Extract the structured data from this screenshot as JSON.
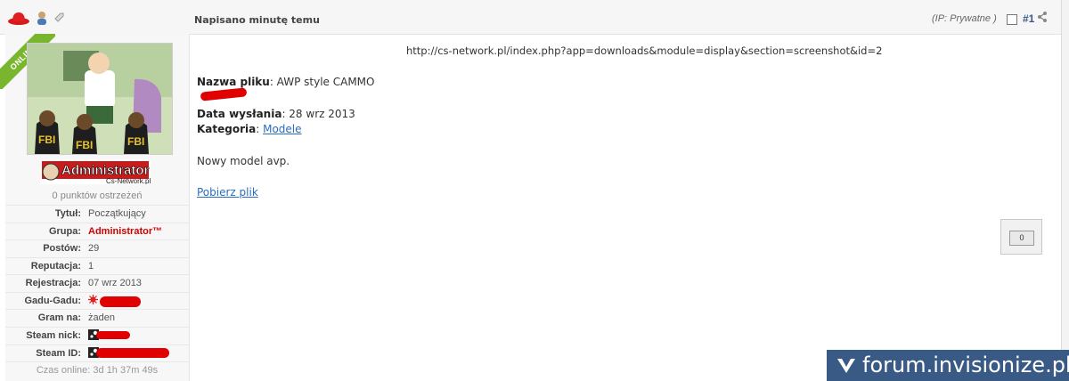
{
  "header": {
    "posted_time": "Napisano minutę temu",
    "ip_label": "(IP: Prywatne )",
    "post_number": "#1"
  },
  "author": {
    "online_label": "ONLINE",
    "rank_image_text": "Administrator",
    "rank_image_subtext": "Cs-Network.pl",
    "warnings": "0 punktów ostrzeżeń",
    "fields": {
      "title_label": "Tytuł:",
      "title_value": "Początkujący",
      "group_label": "Grupa:",
      "group_value": "Administrator™",
      "posts_label": "Postów:",
      "posts_value": "29",
      "rep_label": "Reputacja:",
      "rep_value": "1",
      "reg_label": "Rejestracja:",
      "reg_value": "07 wrz 2013",
      "gg_label": "Gadu-Gadu:",
      "game_label": "Gram na:",
      "game_value": "żaden",
      "steam_nick_label": "Steam nick:",
      "steam_id_label": "Steam ID:",
      "online_time": "Czas online: 3d 1h 37m 49s"
    }
  },
  "post": {
    "url": "http://cs-network.pl/index.php?app=downloads&module=display&section=screenshot&id=2",
    "file_name_label": "Nazwa pliku",
    "file_name_value": ": AWP style CAMMO",
    "date_label": "Data wysłania",
    "date_value": ": 28 wrz 2013",
    "category_label": "Kategoria",
    "category_sep": ": ",
    "category_link": "Modele",
    "description": "Nowy model avp.",
    "download_link": "Pobierz plik"
  },
  "reputation": {
    "count": "0"
  },
  "watermark": {
    "text": "forum.invisionize.pl"
  },
  "colors": {
    "accent": "#3a5a8c",
    "link": "#2a6dbf",
    "group_red": "#d10000",
    "online_green": "#7ab52e"
  }
}
